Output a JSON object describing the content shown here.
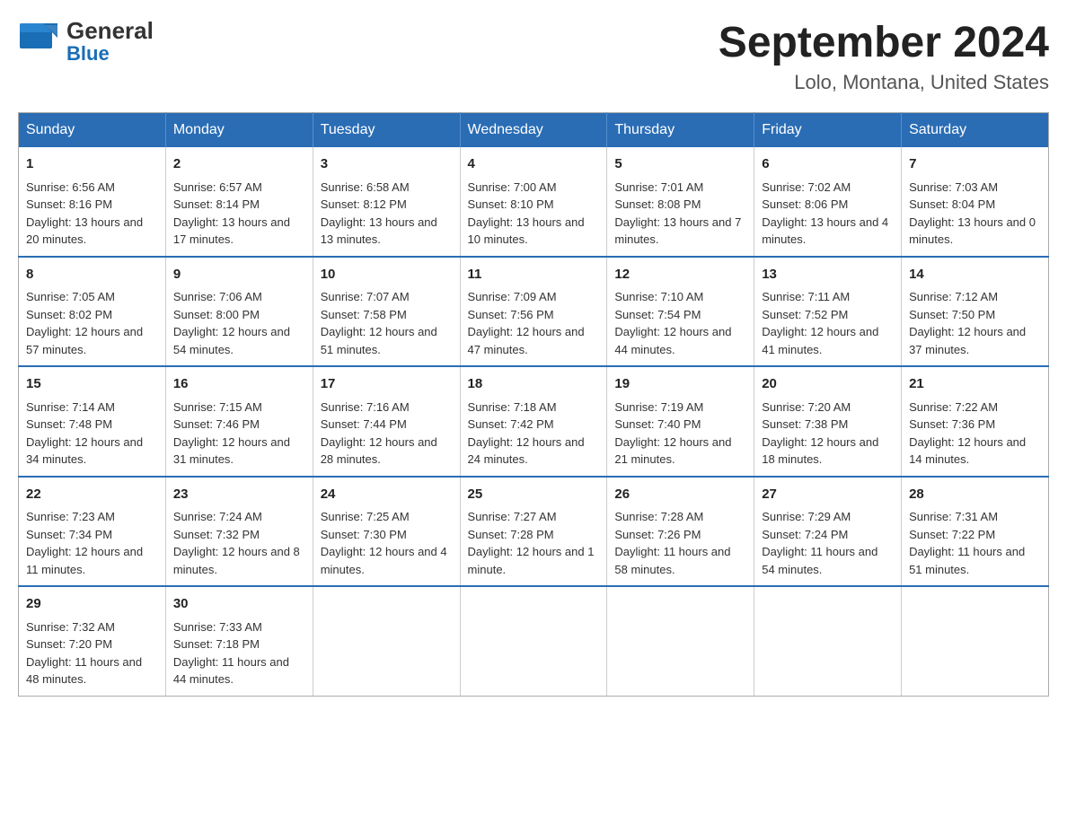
{
  "header": {
    "logo_general": "General",
    "logo_blue": "Blue",
    "month_title": "September 2024",
    "location": "Lolo, Montana, United States"
  },
  "days_of_week": [
    "Sunday",
    "Monday",
    "Tuesday",
    "Wednesday",
    "Thursday",
    "Friday",
    "Saturday"
  ],
  "weeks": [
    [
      {
        "day": "1",
        "sunrise": "Sunrise: 6:56 AM",
        "sunset": "Sunset: 8:16 PM",
        "daylight": "Daylight: 13 hours and 20 minutes."
      },
      {
        "day": "2",
        "sunrise": "Sunrise: 6:57 AM",
        "sunset": "Sunset: 8:14 PM",
        "daylight": "Daylight: 13 hours and 17 minutes."
      },
      {
        "day": "3",
        "sunrise": "Sunrise: 6:58 AM",
        "sunset": "Sunset: 8:12 PM",
        "daylight": "Daylight: 13 hours and 13 minutes."
      },
      {
        "day": "4",
        "sunrise": "Sunrise: 7:00 AM",
        "sunset": "Sunset: 8:10 PM",
        "daylight": "Daylight: 13 hours and 10 minutes."
      },
      {
        "day": "5",
        "sunrise": "Sunrise: 7:01 AM",
        "sunset": "Sunset: 8:08 PM",
        "daylight": "Daylight: 13 hours and 7 minutes."
      },
      {
        "day": "6",
        "sunrise": "Sunrise: 7:02 AM",
        "sunset": "Sunset: 8:06 PM",
        "daylight": "Daylight: 13 hours and 4 minutes."
      },
      {
        "day": "7",
        "sunrise": "Sunrise: 7:03 AM",
        "sunset": "Sunset: 8:04 PM",
        "daylight": "Daylight: 13 hours and 0 minutes."
      }
    ],
    [
      {
        "day": "8",
        "sunrise": "Sunrise: 7:05 AM",
        "sunset": "Sunset: 8:02 PM",
        "daylight": "Daylight: 12 hours and 57 minutes."
      },
      {
        "day": "9",
        "sunrise": "Sunrise: 7:06 AM",
        "sunset": "Sunset: 8:00 PM",
        "daylight": "Daylight: 12 hours and 54 minutes."
      },
      {
        "day": "10",
        "sunrise": "Sunrise: 7:07 AM",
        "sunset": "Sunset: 7:58 PM",
        "daylight": "Daylight: 12 hours and 51 minutes."
      },
      {
        "day": "11",
        "sunrise": "Sunrise: 7:09 AM",
        "sunset": "Sunset: 7:56 PM",
        "daylight": "Daylight: 12 hours and 47 minutes."
      },
      {
        "day": "12",
        "sunrise": "Sunrise: 7:10 AM",
        "sunset": "Sunset: 7:54 PM",
        "daylight": "Daylight: 12 hours and 44 minutes."
      },
      {
        "day": "13",
        "sunrise": "Sunrise: 7:11 AM",
        "sunset": "Sunset: 7:52 PM",
        "daylight": "Daylight: 12 hours and 41 minutes."
      },
      {
        "day": "14",
        "sunrise": "Sunrise: 7:12 AM",
        "sunset": "Sunset: 7:50 PM",
        "daylight": "Daylight: 12 hours and 37 minutes."
      }
    ],
    [
      {
        "day": "15",
        "sunrise": "Sunrise: 7:14 AM",
        "sunset": "Sunset: 7:48 PM",
        "daylight": "Daylight: 12 hours and 34 minutes."
      },
      {
        "day": "16",
        "sunrise": "Sunrise: 7:15 AM",
        "sunset": "Sunset: 7:46 PM",
        "daylight": "Daylight: 12 hours and 31 minutes."
      },
      {
        "day": "17",
        "sunrise": "Sunrise: 7:16 AM",
        "sunset": "Sunset: 7:44 PM",
        "daylight": "Daylight: 12 hours and 28 minutes."
      },
      {
        "day": "18",
        "sunrise": "Sunrise: 7:18 AM",
        "sunset": "Sunset: 7:42 PM",
        "daylight": "Daylight: 12 hours and 24 minutes."
      },
      {
        "day": "19",
        "sunrise": "Sunrise: 7:19 AM",
        "sunset": "Sunset: 7:40 PM",
        "daylight": "Daylight: 12 hours and 21 minutes."
      },
      {
        "day": "20",
        "sunrise": "Sunrise: 7:20 AM",
        "sunset": "Sunset: 7:38 PM",
        "daylight": "Daylight: 12 hours and 18 minutes."
      },
      {
        "day": "21",
        "sunrise": "Sunrise: 7:22 AM",
        "sunset": "Sunset: 7:36 PM",
        "daylight": "Daylight: 12 hours and 14 minutes."
      }
    ],
    [
      {
        "day": "22",
        "sunrise": "Sunrise: 7:23 AM",
        "sunset": "Sunset: 7:34 PM",
        "daylight": "Daylight: 12 hours and 11 minutes."
      },
      {
        "day": "23",
        "sunrise": "Sunrise: 7:24 AM",
        "sunset": "Sunset: 7:32 PM",
        "daylight": "Daylight: 12 hours and 8 minutes."
      },
      {
        "day": "24",
        "sunrise": "Sunrise: 7:25 AM",
        "sunset": "Sunset: 7:30 PM",
        "daylight": "Daylight: 12 hours and 4 minutes."
      },
      {
        "day": "25",
        "sunrise": "Sunrise: 7:27 AM",
        "sunset": "Sunset: 7:28 PM",
        "daylight": "Daylight: 12 hours and 1 minute."
      },
      {
        "day": "26",
        "sunrise": "Sunrise: 7:28 AM",
        "sunset": "Sunset: 7:26 PM",
        "daylight": "Daylight: 11 hours and 58 minutes."
      },
      {
        "day": "27",
        "sunrise": "Sunrise: 7:29 AM",
        "sunset": "Sunset: 7:24 PM",
        "daylight": "Daylight: 11 hours and 54 minutes."
      },
      {
        "day": "28",
        "sunrise": "Sunrise: 7:31 AM",
        "sunset": "Sunset: 7:22 PM",
        "daylight": "Daylight: 11 hours and 51 minutes."
      }
    ],
    [
      {
        "day": "29",
        "sunrise": "Sunrise: 7:32 AM",
        "sunset": "Sunset: 7:20 PM",
        "daylight": "Daylight: 11 hours and 48 minutes."
      },
      {
        "day": "30",
        "sunrise": "Sunrise: 7:33 AM",
        "sunset": "Sunset: 7:18 PM",
        "daylight": "Daylight: 11 hours and 44 minutes."
      },
      null,
      null,
      null,
      null,
      null
    ]
  ]
}
